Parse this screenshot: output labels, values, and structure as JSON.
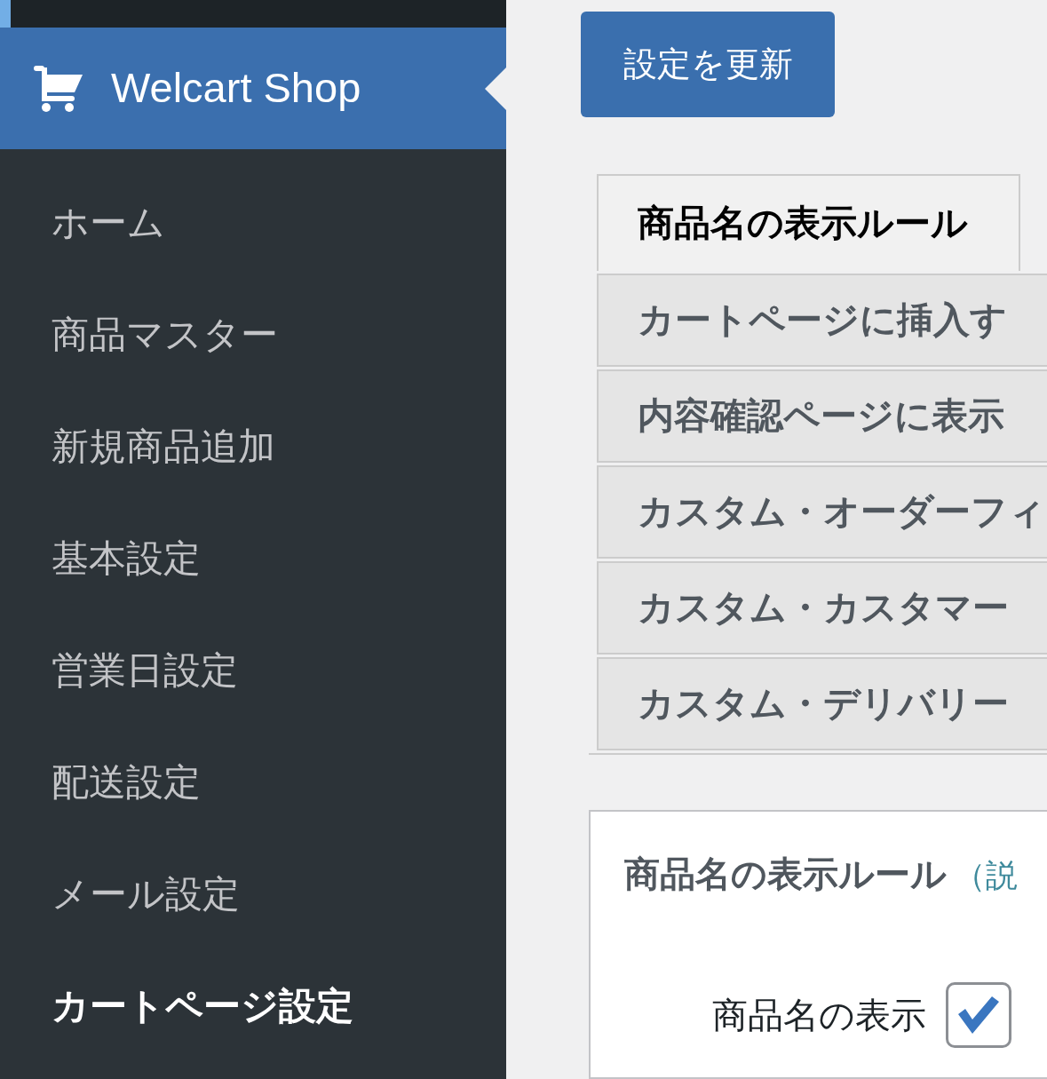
{
  "sidebar": {
    "header": {
      "title": "Welcart Shop"
    },
    "items": [
      {
        "label": "ホーム",
        "selected": false
      },
      {
        "label": "商品マスター",
        "selected": false
      },
      {
        "label": "新規商品追加",
        "selected": false
      },
      {
        "label": "基本設定",
        "selected": false
      },
      {
        "label": "営業日設定",
        "selected": false
      },
      {
        "label": "配送設定",
        "selected": false
      },
      {
        "label": "メール設定",
        "selected": false
      },
      {
        "label": "カートページ設定",
        "selected": true
      }
    ]
  },
  "update_button": "設定を更新",
  "tabs": [
    {
      "label": "商品名の表示ルール",
      "selected": true
    },
    {
      "label": "カートページに挿入す",
      "selected": false
    },
    {
      "label": "内容確認ページに表示",
      "selected": false
    },
    {
      "label": "カスタム・オーダーフィ",
      "selected": false
    },
    {
      "label": "カスタム・カスタマー",
      "selected": false
    },
    {
      "label": "カスタム・デリバリー",
      "selected": false
    }
  ],
  "panel": {
    "title": "商品名の表示ルール",
    "help_link": "（説",
    "fields": [
      {
        "label": "商品名の表示",
        "checked": true
      }
    ]
  }
}
